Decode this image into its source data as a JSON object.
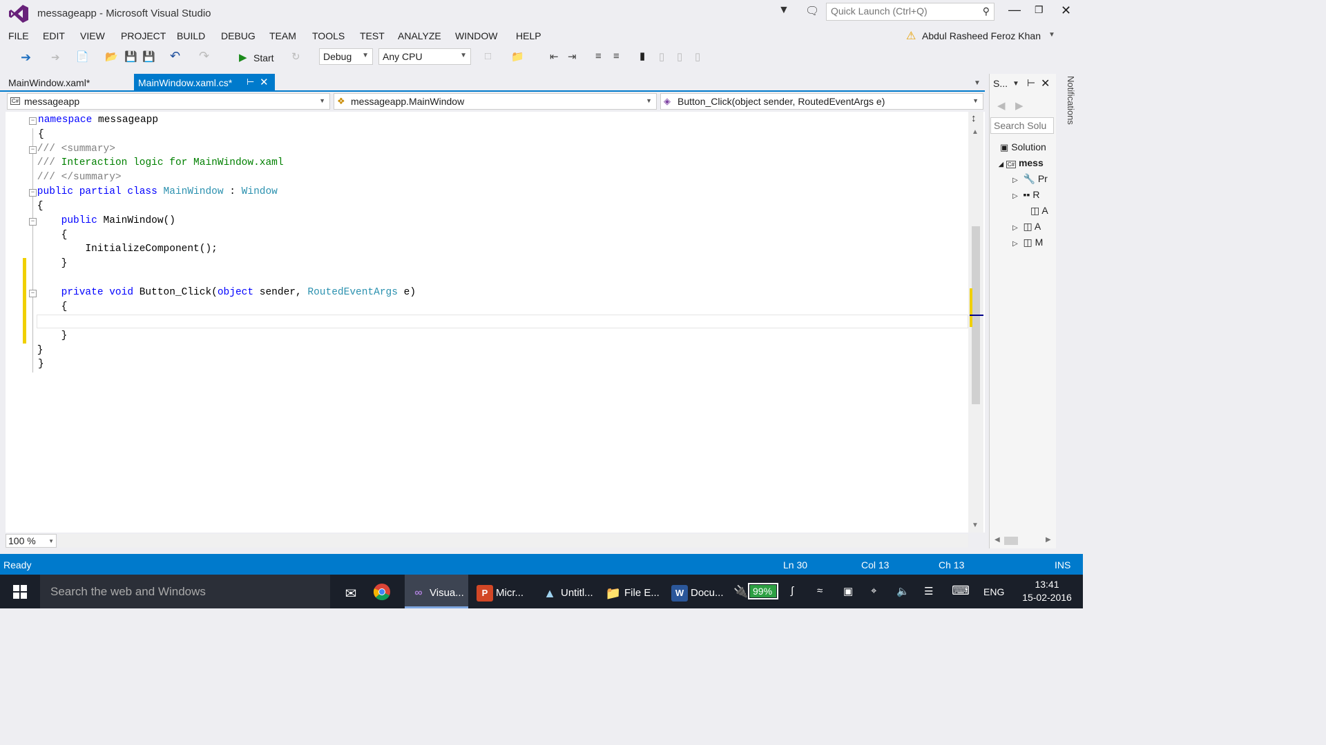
{
  "window": {
    "title": "messageapp - Microsoft Visual Studio",
    "quick_launch_placeholder": "Quick Launch (Ctrl+Q)",
    "user": "Abdul Rasheed Feroz Khan"
  },
  "menu": [
    "FILE",
    "EDIT",
    "VIEW",
    "PROJECT",
    "BUILD",
    "DEBUG",
    "TEAM",
    "TOOLS",
    "TEST",
    "ANALYZE",
    "WINDOW",
    "HELP"
  ],
  "toolbar": {
    "start_label": "Start",
    "config": "Debug",
    "platform": "Any CPU"
  },
  "tabs": {
    "inactive": "MainWindow.xaml*",
    "active": "MainWindow.xaml.cs*"
  },
  "navbar": {
    "project": "messageapp",
    "type": "messageapp.MainWindow",
    "member": "Button_Click(object sender, RoutedEventArgs e)"
  },
  "code": {
    "l1_kw": "namespace",
    "l1_name": " messageapp",
    "l2": "{",
    "l3": "    /// <summary>",
    "l4_prefix": "    /// ",
    "l4_text": "Interaction logic for MainWindow.xaml",
    "l5": "    /// </summary>",
    "l6_kw": "    public partial class ",
    "l6_type": "MainWindow",
    "l6_sep": " : ",
    "l6_base": "Window",
    "l7": "    {",
    "l8_kw": "        public ",
    "l8_rest": "MainWindow()",
    "l9": "        {",
    "l10": "            InitializeComponent();",
    "l11": "        }",
    "l13_kw": "        private void ",
    "l13_name": "Button_Click(",
    "l13_kw2": "object",
    "l13_p1": " sender, ",
    "l13_type": "RoutedEventArgs",
    "l13_p2": " e)",
    "l14": "        {",
    "l16": "        }",
    "l17": "    }",
    "l18": "}"
  },
  "editor": {
    "zoom": "100 %"
  },
  "solution_explorer": {
    "title": "S...",
    "search_placeholder": "Search Solu",
    "items": [
      "Solution",
      "mess",
      "Pr",
      "R",
      "A",
      "A",
      "M"
    ]
  },
  "notifications_label": "Notifications",
  "status": {
    "state": "Ready",
    "ln": "Ln 30",
    "col": "Col 13",
    "ch": "Ch 13",
    "mode": "INS"
  },
  "taskbar": {
    "search_placeholder": "Search the web and Windows",
    "apps": [
      "Visua...",
      "Micr...",
      "Untitl...",
      "File E...",
      "Docu..."
    ],
    "battery": "99%",
    "lang": "ENG",
    "time": "13:41",
    "date": "15-02-2016"
  }
}
